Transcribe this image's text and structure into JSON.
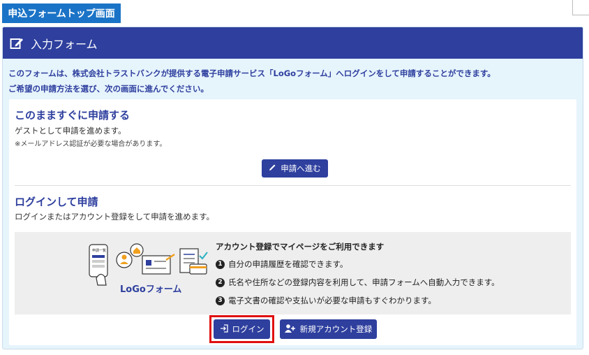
{
  "top_tab": {
    "label": "申込フォームトップ画面"
  },
  "header": {
    "title": "入力フォーム"
  },
  "intro": {
    "line1": "このフォームは、株式会社トラストバンクが提供する電子申請サービス「LoGoフォーム」へログインをして申請することができます。",
    "line2": "ご希望の申請方法を選び、次の画面に進んでください。"
  },
  "guest": {
    "title": "このまますぐに申請する",
    "text": "ゲストとして申請を進めます。",
    "note": "※メールアドレス認証が必要な場合があります。",
    "button": "申請へ進む"
  },
  "login": {
    "title": "ログインして申請",
    "text": "ログインまたはアカウント登録をして申請を進めます。",
    "features_title": "アカウント登録でマイページをご利用できます",
    "features": [
      {
        "num": "1",
        "text": "自分の申請履歴を確認できます。"
      },
      {
        "num": "2",
        "text": "氏名や住所などの登録内容を利用して、申請フォームへ自動入力できます。"
      },
      {
        "num": "3",
        "text": "電子文書の確認や支払いが必要な申請もすぐわかります。"
      }
    ],
    "logo_text": "LoGoフォーム",
    "illustration_label": "申請一覧",
    "login_button": "ログイン",
    "register_button": "新規アカウント登録"
  },
  "colors": {
    "primary": "#2e3f9e",
    "tab": "#1a73c6",
    "highlight": "#e01010",
    "background": "#e6f4fc"
  }
}
